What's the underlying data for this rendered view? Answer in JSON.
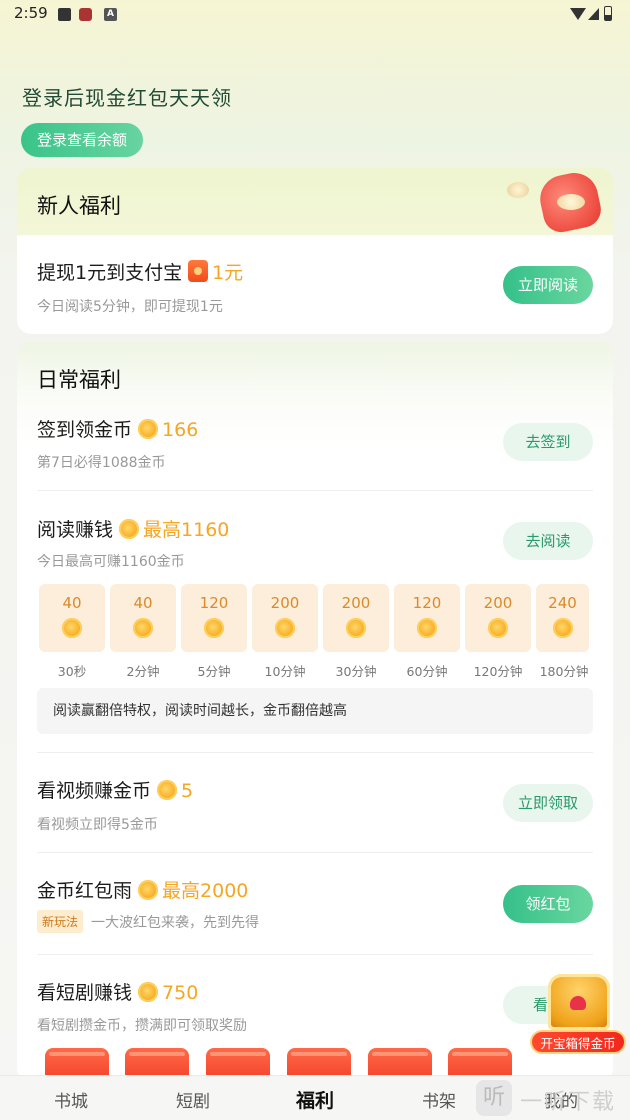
{
  "status_bar": {
    "time": "2:59",
    "badge_a": "A"
  },
  "hero": {
    "title": "登录后现金红包天天领",
    "login_button": "登录查看余额"
  },
  "newcomer": {
    "section_title": "新人福利",
    "task": {
      "title": "提现1元到支付宝",
      "reward": "1元",
      "subtitle": "今日阅读5分钟，即可提现1元",
      "button": "立即阅读"
    }
  },
  "daily": {
    "section_title": "日常福利",
    "checkin": {
      "title": "签到领金币",
      "reward": "166",
      "subtitle": "第7日必得1088金币",
      "button": "去签到"
    },
    "reading": {
      "title": "阅读赚钱",
      "reward": "最高1160",
      "subtitle": "今日最高可赚1160金币",
      "button": "去阅读",
      "tiers": [
        {
          "coins": "40",
          "time": "30秒"
        },
        {
          "coins": "40",
          "time": "2分钟"
        },
        {
          "coins": "120",
          "time": "5分钟"
        },
        {
          "coins": "200",
          "time": "10分钟"
        },
        {
          "coins": "200",
          "time": "30分钟"
        },
        {
          "coins": "120",
          "time": "60分钟"
        },
        {
          "coins": "200",
          "time": "120分钟"
        },
        {
          "coins": "240",
          "time": "180分钟"
        }
      ],
      "tip": "阅读赢翻倍特权，阅读时间越长，金币翻倍越高"
    },
    "video": {
      "title": "看视频赚金币",
      "reward": "5",
      "subtitle": "看视频立即得5金币",
      "button": "立即领取"
    },
    "rain": {
      "title": "金币红包雨",
      "reward": "最高2000",
      "tag": "新玩法",
      "subtitle": "一大波红包来袭，先到先得",
      "button": "领红包"
    },
    "drama": {
      "title": "看短剧赚钱",
      "reward": "750",
      "subtitle": "看短剧攒金币，攒满即可领取奖励",
      "button": "看短"
    }
  },
  "floating_chest": {
    "label": "开宝箱得金币"
  },
  "tabbar": {
    "tabs": [
      "书城",
      "短剧",
      "福利",
      "书架",
      "我的"
    ],
    "active": "福利"
  },
  "watermark": {
    "logo": "听",
    "text": "一听下载"
  }
}
